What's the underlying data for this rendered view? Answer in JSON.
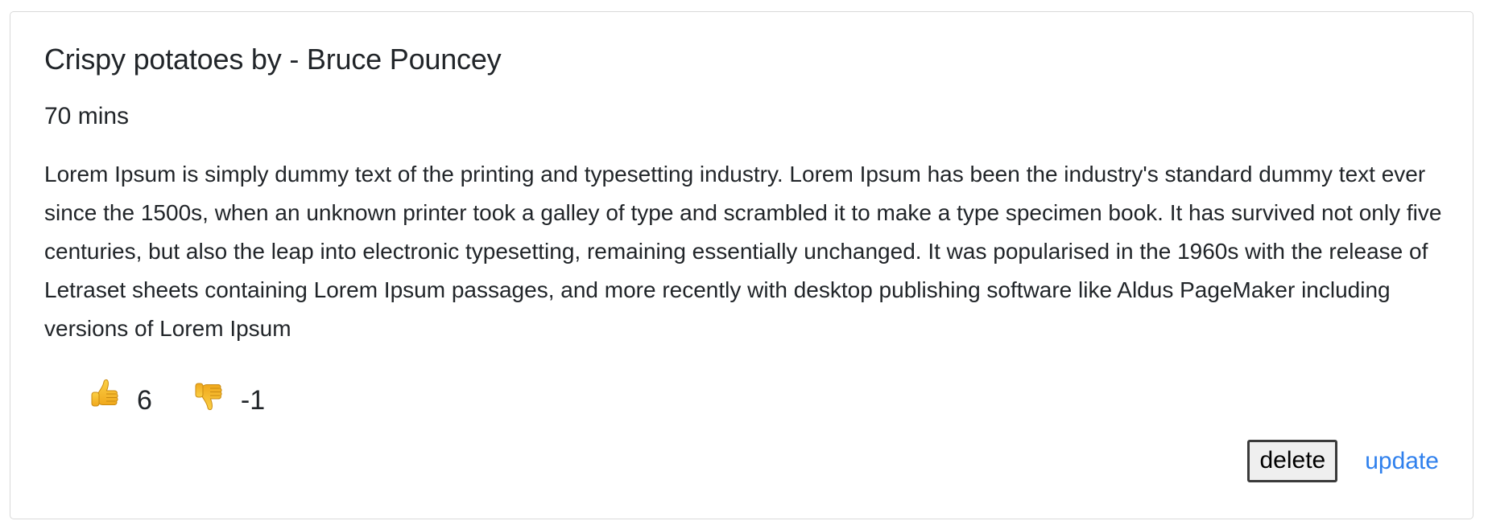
{
  "recipe": {
    "title": "Crispy potatoes by - Bruce Pouncey",
    "time": "70 mins",
    "description": "Lorem Ipsum is simply dummy text of the printing and typesetting industry. Lorem Ipsum has been the industry's standard dummy text ever since the 1500s, when an unknown printer took a galley of type and scrambled it to make a type specimen book. It has survived not only five centuries, but also the leap into electronic typesetting, remaining essentially unchanged. It was popularised in the 1960s with the release of Letraset sheets containing Lorem Ipsum passages, and more recently with desktop publishing software like Aldus PageMaker including versions of Lorem Ipsum"
  },
  "votes": {
    "up": {
      "icon": "thumbs-up-icon",
      "count": "6"
    },
    "down": {
      "icon": "thumbs-down-icon",
      "count": "-1"
    }
  },
  "actions": {
    "delete_label": "delete",
    "update_label": "update"
  },
  "colors": {
    "link": "#2f80ed",
    "emoji": "#f5b822",
    "border": "#d9d9d9"
  }
}
